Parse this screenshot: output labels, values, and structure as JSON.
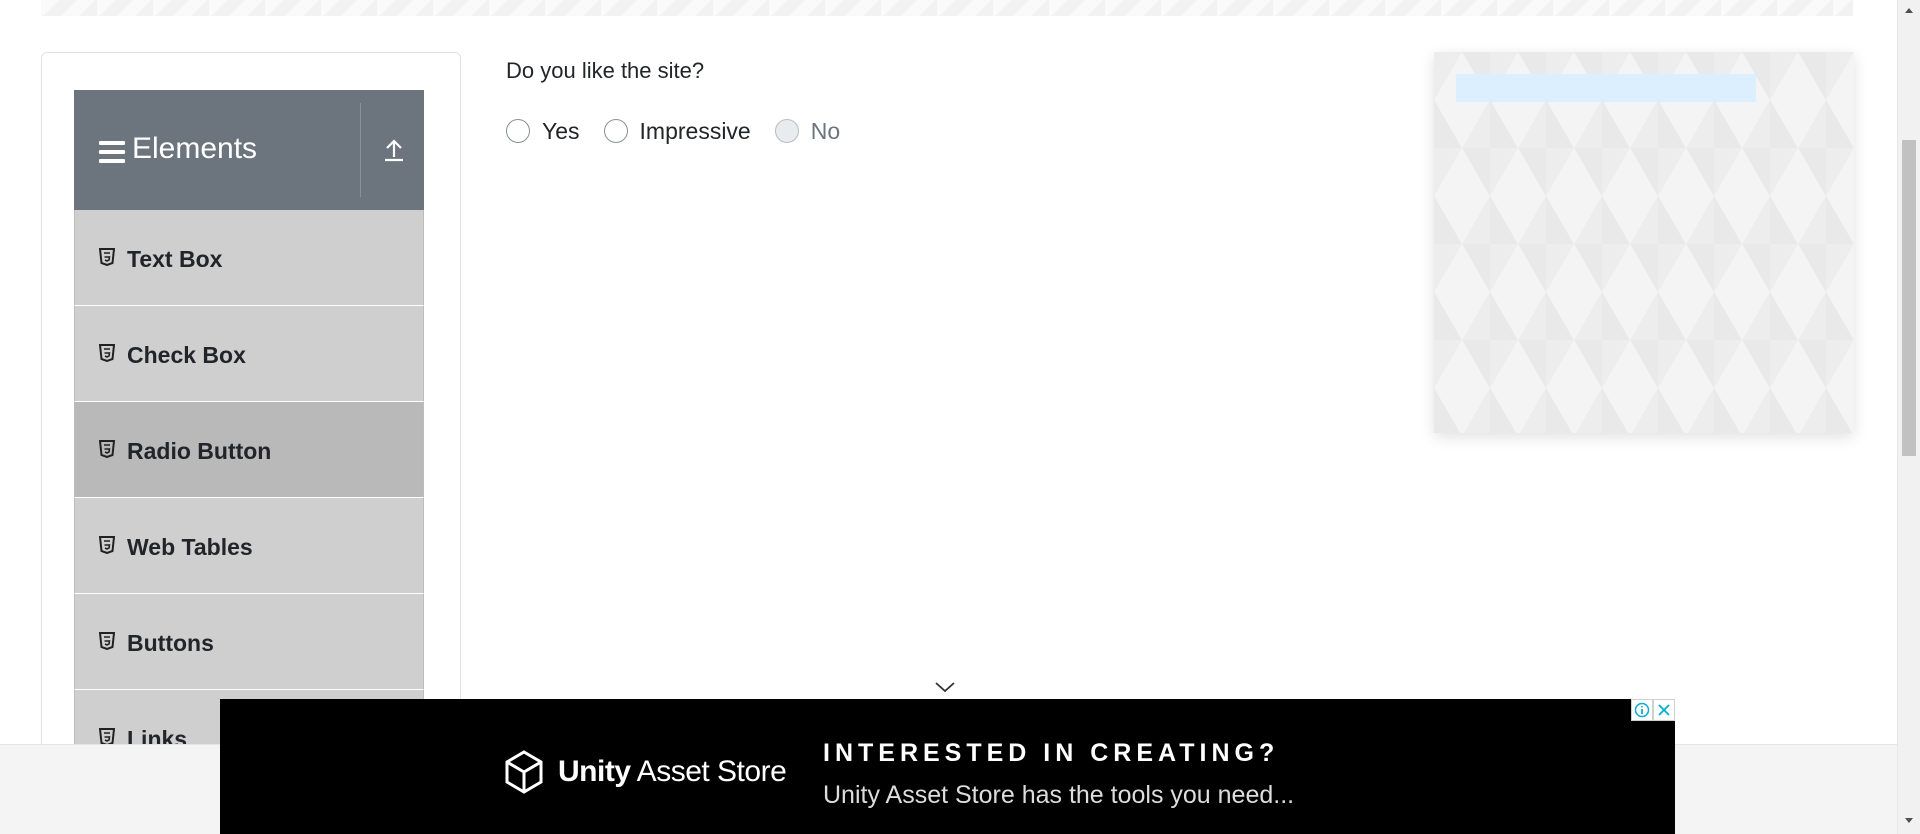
{
  "sidebar": {
    "group_title": "Elements",
    "items": [
      {
        "label": "Text Box",
        "active": false
      },
      {
        "label": "Check Box",
        "active": false
      },
      {
        "label": "Radio Button",
        "active": true
      },
      {
        "label": "Web Tables",
        "active": false
      },
      {
        "label": "Buttons",
        "active": false
      },
      {
        "label": "Links",
        "active": false
      }
    ]
  },
  "main": {
    "question": "Do you like the site?",
    "options": [
      {
        "label": "Yes",
        "disabled": false
      },
      {
        "label": "Impressive",
        "disabled": false
      },
      {
        "label": "No",
        "disabled": true
      }
    ]
  },
  "bottom_ad": {
    "brand_bold": "Unity",
    "brand_rest": " Asset Store",
    "headline": "INTERESTED IN CREATING?",
    "subline": "Unity Asset Store has the tools you need..."
  },
  "colors": {
    "header_bg": "#6c757d",
    "menu_item_bg": "#cfcfcf",
    "menu_item_active_bg": "#b9b9b9",
    "ad_bg": "#000000"
  },
  "icons": {
    "menu": "hamburger-icon",
    "collapse": "arrow-up-icon",
    "item": "html5-icon",
    "scroll_hint": "chevron-down-icon",
    "ad_info": "info-icon",
    "ad_close": "close-icon"
  }
}
